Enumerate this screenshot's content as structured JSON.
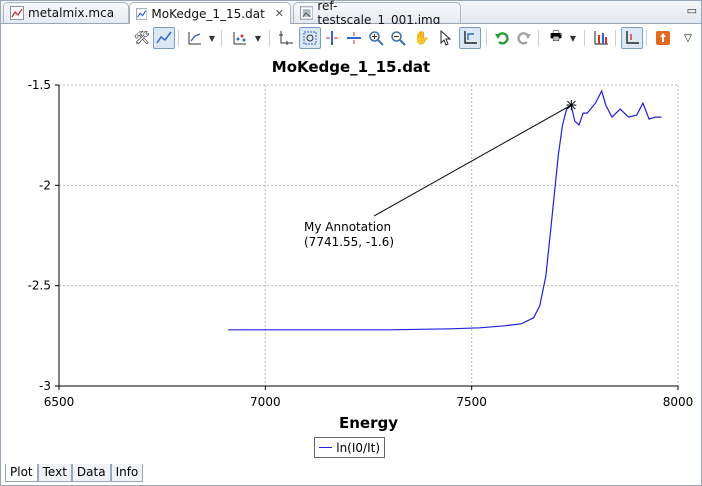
{
  "tabs": [
    {
      "label": "metalmix.mca",
      "active": false,
      "closable": false
    },
    {
      "label": "MoKedge_1_15.dat",
      "active": true,
      "closable": true
    },
    {
      "label": "ref-testscale_1_001.img",
      "active": false,
      "closable": false
    }
  ],
  "tab_overflow_icon": "minimize-icon",
  "toolbar": {
    "icons": [
      "configure-icon",
      "curve-settings-icon",
      "line-style-icon",
      "scatter-icon",
      "axes-icon",
      "zoom-box-icon",
      "zoom-x-icon",
      "zoom-y-icon",
      "zoom-in-icon",
      "zoom-out-icon",
      "pan-icon",
      "select-icon",
      "autoscale-icon",
      "undo-icon",
      "redo-icon",
      "print-icon",
      "bar-icon",
      "axis-options-icon",
      "export-icon",
      "view-menu-icon"
    ]
  },
  "plot_title": "MoKedge_1_15.dat",
  "chart_data": {
    "type": "line",
    "title": "MoKedge_1_15.dat",
    "xlabel": "Energy",
    "ylabel": "",
    "xlim": [
      6500,
      8000
    ],
    "ylim": [
      -3,
      -1.5
    ],
    "xticks": [
      6500,
      7000,
      7500,
      8000
    ],
    "yticks": [
      -1.5,
      -2,
      -2.5,
      -3
    ],
    "grid": true,
    "legend_position": "bottom-center",
    "series": [
      {
        "name": "ln(I0/It)",
        "color": "#2020dd",
        "x": [
          6910,
          7100,
          7300,
          7450,
          7520,
          7580,
          7620,
          7650,
          7665,
          7680,
          7690,
          7700,
          7710,
          7720,
          7730,
          7741,
          7750,
          7760,
          7770,
          7780,
          7800,
          7815,
          7825,
          7840,
          7860,
          7880,
          7900,
          7915,
          7930,
          7945,
          7960
        ],
        "y": [
          -2.72,
          -2.72,
          -2.72,
          -2.715,
          -2.71,
          -2.7,
          -2.69,
          -2.66,
          -2.6,
          -2.45,
          -2.25,
          -2.05,
          -1.85,
          -1.7,
          -1.62,
          -1.6,
          -1.68,
          -1.7,
          -1.64,
          -1.64,
          -1.59,
          -1.53,
          -1.6,
          -1.66,
          -1.62,
          -1.66,
          -1.65,
          -1.59,
          -1.67,
          -1.66,
          -1.66
        ]
      }
    ],
    "annotation": {
      "text_lines": [
        "My Annotation",
        "(7741.55, -1.6)"
      ],
      "x": 7741.55,
      "y": -1.6
    }
  },
  "legend": {
    "label": "ln(I0/It)"
  },
  "bottom_tabs": [
    {
      "label": "Plot",
      "active": true
    },
    {
      "label": "Text",
      "active": false
    },
    {
      "label": "Data",
      "active": false
    },
    {
      "label": "Info",
      "active": false
    }
  ]
}
